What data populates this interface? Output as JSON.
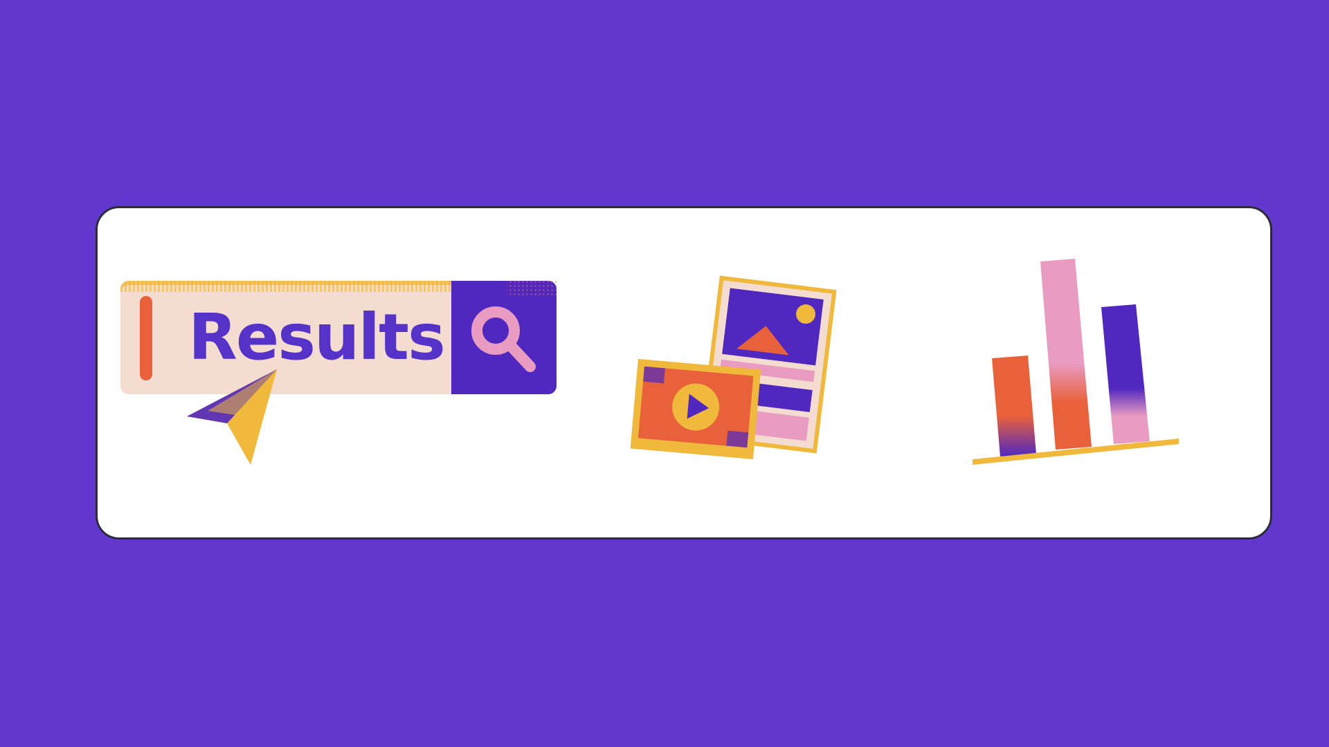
{
  "search": {
    "text": "Results"
  },
  "icons": {
    "search_button": "search-icon",
    "cursor": "pointer-arrow-icon",
    "media": "image-and-video-icon",
    "chart": "bar-chart-icon"
  },
  "colors": {
    "background": "#6237CD",
    "card": "#FFFFFF",
    "purple": "#5028C0",
    "orange": "#E8613B",
    "yellow": "#F0B93C",
    "pink": "#E99BC2",
    "cream": "#F4DCD1"
  }
}
